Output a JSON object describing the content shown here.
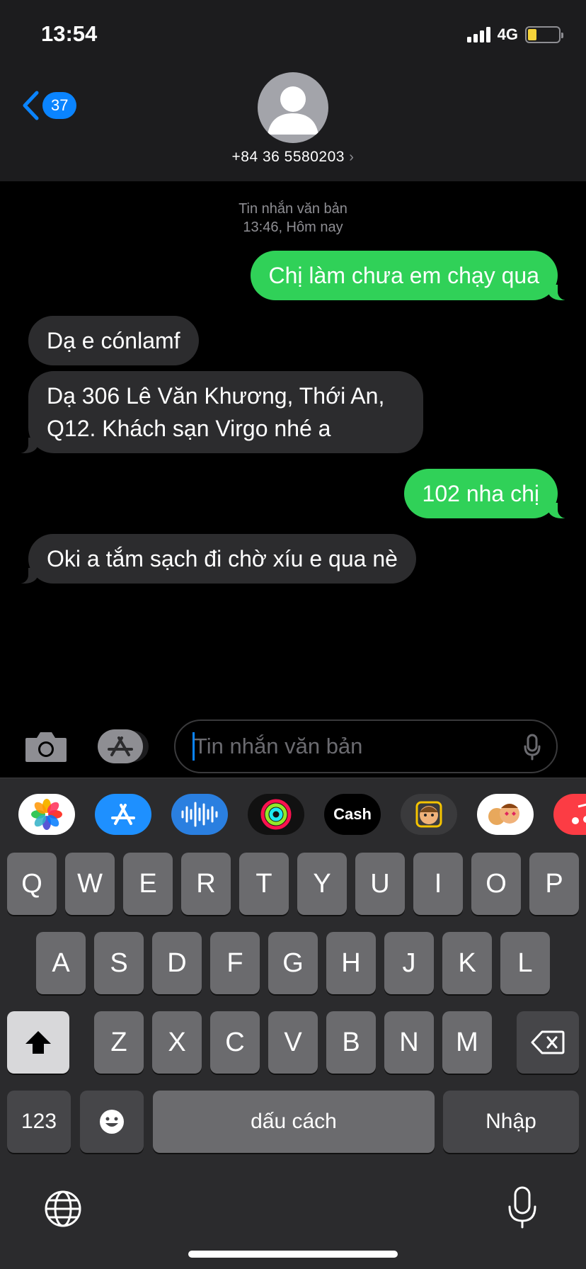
{
  "status_bar": {
    "time": "13:54",
    "network": "4G"
  },
  "header": {
    "back_count": "37",
    "contact": "+84 36 5580203",
    "contact_chevron": "›"
  },
  "conversation": {
    "meta_line1": "Tin nhắn văn bản",
    "meta_line2": "13:46, Hôm nay",
    "messages": [
      {
        "direction": "sent",
        "text": "Chị làm chưa em chạy qua"
      },
      {
        "direction": "received",
        "text": "Dạ e cónlamf"
      },
      {
        "direction": "received",
        "text": "Dạ  306 Lê Văn Khương, Thới An, Q12. Khách sạn Virgo nhé a"
      },
      {
        "direction": "sent",
        "text": "102 nha chị"
      },
      {
        "direction": "received",
        "text": "Oki a tắm sạch đi chờ xíu e qua nè"
      }
    ]
  },
  "input": {
    "placeholder": "Tin nhắn văn bản"
  },
  "app_strip": {
    "apps": [
      "photos-app",
      "app-store-app",
      "audio-message-app",
      "fitness-app",
      "apple-cash-app",
      "memoji-app",
      "animoji-stickers-app",
      "music-app"
    ],
    "cash_label": "Cash"
  },
  "keyboard": {
    "row1": [
      "Q",
      "W",
      "E",
      "R",
      "T",
      "Y",
      "U",
      "I",
      "O",
      "P"
    ],
    "row2": [
      "A",
      "S",
      "D",
      "F",
      "G",
      "H",
      "J",
      "K",
      "L"
    ],
    "row3": [
      "Z",
      "X",
      "C",
      "V",
      "B",
      "N",
      "M"
    ],
    "numbers": "123",
    "space": "dấu cách",
    "return": "Nhập"
  },
  "colors": {
    "sent_bubble": "#30d158",
    "received_bubble": "#2c2c2e",
    "accent": "#0a84ff",
    "battery": "#f5d33a"
  }
}
